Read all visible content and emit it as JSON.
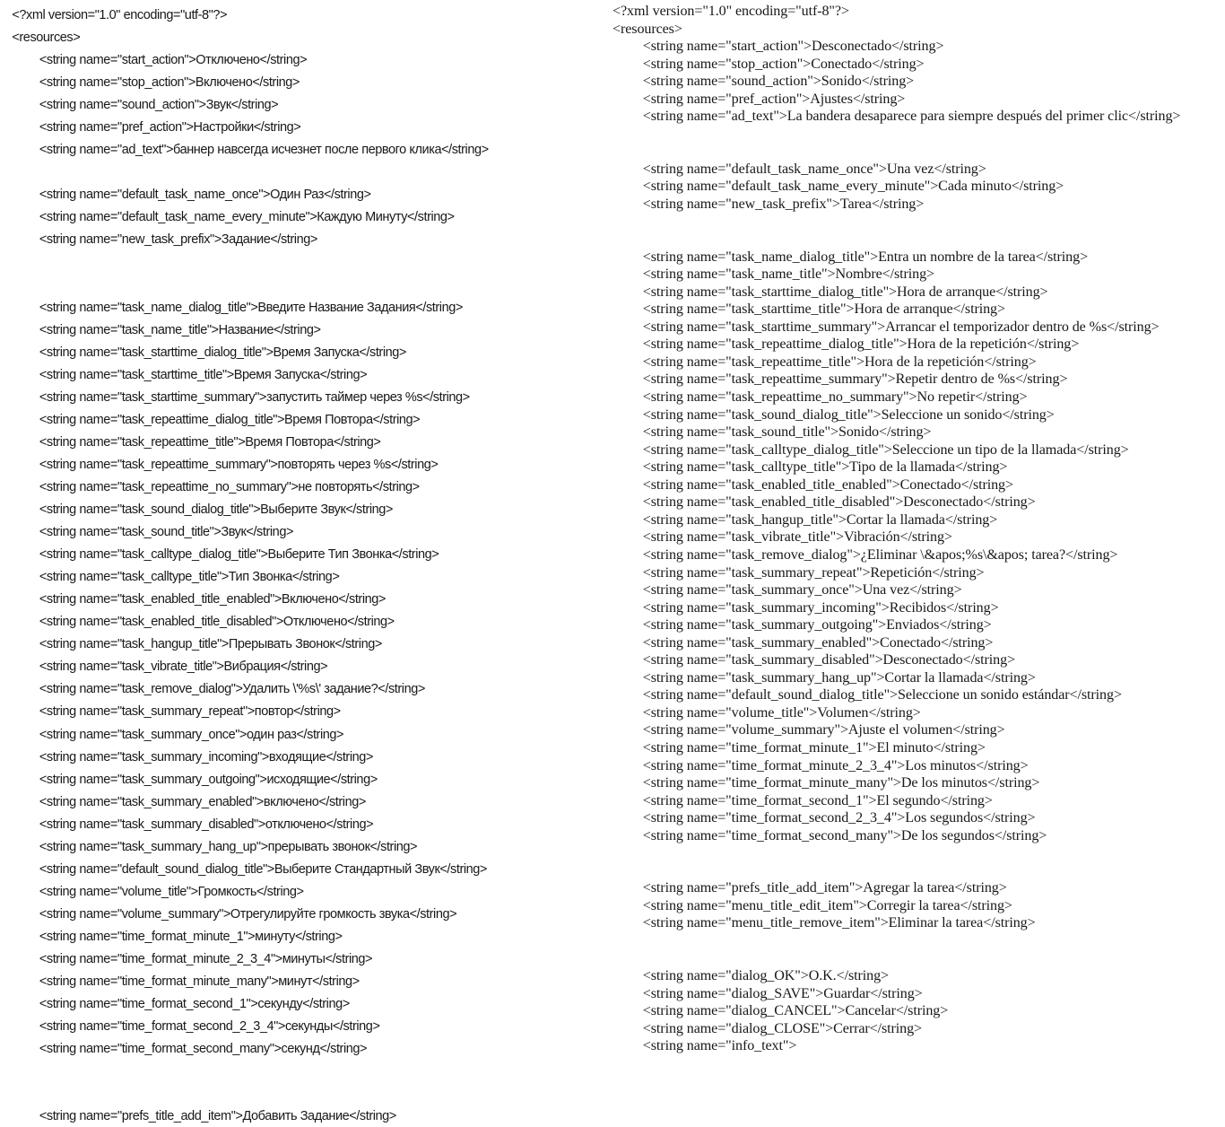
{
  "document": {
    "type": "xml-resource-comparison",
    "background_color": "#ffffff",
    "text_color": "#181818",
    "columns": [
      {
        "id": "left",
        "language": "Russian",
        "font_style": "sans-serif",
        "lines": [
          {
            "indent": 0,
            "text": "<?xml version=\"1.0\" encoding=\"utf-8\"?>"
          },
          {
            "indent": 0,
            "text": "<resources>"
          },
          {
            "indent": 1,
            "text": "<string name=\"start_action\">Отключено</string>"
          },
          {
            "indent": 1,
            "text": "<string name=\"stop_action\">Включено</string>"
          },
          {
            "indent": 1,
            "text": "<string name=\"sound_action\">Звук</string>"
          },
          {
            "indent": 1,
            "text": "<string name=\"pref_action\">Настройки</string>"
          },
          {
            "indent": 1,
            "text": "<string name=\"ad_text\">баннер навсегда исчезнет после первого клика</string>"
          },
          {
            "indent": 0,
            "text": ""
          },
          {
            "indent": 1,
            "text": "<string name=\"default_task_name_once\">Один Раз</string>"
          },
          {
            "indent": 1,
            "text": "<string name=\"default_task_name_every_minute\">Каждую Минуту</string>"
          },
          {
            "indent": 1,
            "text": "<string name=\"new_task_prefix\">Задание</string>"
          },
          {
            "indent": 0,
            "text": ""
          },
          {
            "indent": 0,
            "text": ""
          },
          {
            "indent": 1,
            "text": "<string name=\"task_name_dialog_title\">Введите Название Задания</string>"
          },
          {
            "indent": 1,
            "text": "<string name=\"task_name_title\">Название</string>"
          },
          {
            "indent": 1,
            "text": "<string name=\"task_starttime_dialog_title\">Время Запуска</string>"
          },
          {
            "indent": 1,
            "text": "<string name=\"task_starttime_title\">Время Запуска</string>"
          },
          {
            "indent": 1,
            "text": "<string name=\"task_starttime_summary\">запустить таймер через %s</string>"
          },
          {
            "indent": 1,
            "text": "<string name=\"task_repeattime_dialog_title\">Время Повтора</string>"
          },
          {
            "indent": 1,
            "text": "<string name=\"task_repeattime_title\">Время Повтора</string>"
          },
          {
            "indent": 1,
            "text": "<string name=\"task_repeattime_summary\">повторять через %s</string>"
          },
          {
            "indent": 1,
            "text": "<string name=\"task_repeattime_no_summary\">не повторять</string>"
          },
          {
            "indent": 1,
            "text": "<string name=\"task_sound_dialog_title\">Выберите Звук</string>"
          },
          {
            "indent": 1,
            "text": "<string name=\"task_sound_title\">Звук</string>"
          },
          {
            "indent": 1,
            "text": "<string name=\"task_calltype_dialog_title\">Выберите Тип Звонка</string>"
          },
          {
            "indent": 1,
            "text": "<string name=\"task_calltype_title\">Тип Звонка</string>"
          },
          {
            "indent": 1,
            "text": "<string name=\"task_enabled_title_enabled\">Включено</string>"
          },
          {
            "indent": 1,
            "text": "<string name=\"task_enabled_title_disabled\">Отключено</string>"
          },
          {
            "indent": 1,
            "text": "<string name=\"task_hangup_title\">Прерывать Звонок</string>"
          },
          {
            "indent": 1,
            "text": "<string name=\"task_vibrate_title\">Вибрация</string>"
          },
          {
            "indent": 1,
            "text": "<string name=\"task_remove_dialog\">Удалить \\'%s\\' задание?</string>"
          },
          {
            "indent": 1,
            "text": "<string name=\"task_summary_repeat\">повтор</string>"
          },
          {
            "indent": 1,
            "text": "<string name=\"task_summary_once\">один раз</string>"
          },
          {
            "indent": 1,
            "text": "<string name=\"task_summary_incoming\">входящие</string>"
          },
          {
            "indent": 1,
            "text": "<string name=\"task_summary_outgoing\">исходящие</string>"
          },
          {
            "indent": 1,
            "text": "<string name=\"task_summary_enabled\">включено</string>"
          },
          {
            "indent": 1,
            "text": "<string name=\"task_summary_disabled\">отключено</string>"
          },
          {
            "indent": 1,
            "text": "<string name=\"task_summary_hang_up\">прерывать звонок</string>"
          },
          {
            "indent": 1,
            "text": "<string name=\"default_sound_dialog_title\">Выберите Стандартный Звук</string>"
          },
          {
            "indent": 1,
            "text": "<string name=\"volume_title\">Громкость</string>"
          },
          {
            "indent": 1,
            "text": "<string name=\"volume_summary\">Отрегулируйте громкость звука</string>"
          },
          {
            "indent": 1,
            "text": "<string name=\"time_format_minute_1\">минуту</string>"
          },
          {
            "indent": 1,
            "text": "<string name=\"time_format_minute_2_3_4\">минуты</string>"
          },
          {
            "indent": 1,
            "text": "<string name=\"time_format_minute_many\">минут</string>"
          },
          {
            "indent": 1,
            "text": "<string name=\"time_format_second_1\">секунду</string>"
          },
          {
            "indent": 1,
            "text": "<string name=\"time_format_second_2_3_4\">секунды</string>"
          },
          {
            "indent": 1,
            "text": "<string name=\"time_format_second_many\">секунд</string>"
          },
          {
            "indent": 0,
            "text": ""
          },
          {
            "indent": 0,
            "text": ""
          },
          {
            "indent": 1,
            "text": "<string name=\"prefs_title_add_item\">Добавить Задание</string>"
          }
        ]
      },
      {
        "id": "right",
        "language": "Spanish",
        "font_style": "serif",
        "lines": [
          {
            "indent": 0,
            "text": "<?xml version=\"1.0\" encoding=\"utf-8\"?>"
          },
          {
            "indent": 0,
            "text": "<resources>"
          },
          {
            "indent": 1,
            "text": "<string name=\"start_action\">Desconectado</string>"
          },
          {
            "indent": 1,
            "text": "<string name=\"stop_action\">Conectado</string>"
          },
          {
            "indent": 1,
            "text": "<string name=\"sound_action\">Sonido</string>"
          },
          {
            "indent": 1,
            "text": "<string name=\"pref_action\">Ajustes</string>"
          },
          {
            "indent": 1,
            "text": "<string name=\"ad_text\">La bandera desaparece para siempre después del primer clic</string>"
          },
          {
            "indent": 0,
            "text": ""
          },
          {
            "indent": 0,
            "text": ""
          },
          {
            "indent": 1,
            "text": "<string name=\"default_task_name_once\">Una vez</string>"
          },
          {
            "indent": 1,
            "text": "<string name=\"default_task_name_every_minute\">Cada minuto</string>"
          },
          {
            "indent": 1,
            "text": "<string name=\"new_task_prefix\">Tarea</string>"
          },
          {
            "indent": 0,
            "text": ""
          },
          {
            "indent": 0,
            "text": ""
          },
          {
            "indent": 1,
            "text": "<string name=\"task_name_dialog_title\">Entra un nombre de la tarea</string>"
          },
          {
            "indent": 1,
            "text": "<string name=\"task_name_title\">Nombre</string>"
          },
          {
            "indent": 1,
            "text": "<string name=\"task_starttime_dialog_title\">Hora de arranque</string>"
          },
          {
            "indent": 1,
            "text": "<string name=\"task_starttime_title\">Hora de arranque</string>"
          },
          {
            "indent": 1,
            "text": "<string name=\"task_starttime_summary\">Arrancar el temporizador dentro de %s</string>"
          },
          {
            "indent": 1,
            "text": "<string name=\"task_repeattime_dialog_title\">Hora de la repetición</string>"
          },
          {
            "indent": 1,
            "text": "<string name=\"task_repeattime_title\">Hora de la repetición</string>"
          },
          {
            "indent": 1,
            "text": "<string name=\"task_repeattime_summary\">Repetir dentro de %s</string>"
          },
          {
            "indent": 1,
            "text": "<string name=\"task_repeattime_no_summary\">No repetir</string>"
          },
          {
            "indent": 1,
            "text": "<string name=\"task_sound_dialog_title\">Seleccione un sonido</string>"
          },
          {
            "indent": 1,
            "text": "<string name=\"task_sound_title\">Sonido</string>"
          },
          {
            "indent": 1,
            "text": "<string name=\"task_calltype_dialog_title\">Seleccione un tipo de la llamada</string>"
          },
          {
            "indent": 1,
            "text": "<string name=\"task_calltype_title\">Tipo de la llamada</string>"
          },
          {
            "indent": 1,
            "text": "<string name=\"task_enabled_title_enabled\">Conectado</string>"
          },
          {
            "indent": 1,
            "text": "<string name=\"task_enabled_title_disabled\">Desconectado</string>"
          },
          {
            "indent": 1,
            "text": "<string name=\"task_hangup_title\">Cortar la llamada</string>"
          },
          {
            "indent": 1,
            "text": "<string name=\"task_vibrate_title\">Vibración</string>"
          },
          {
            "indent": 1,
            "text": "<string name=\"task_remove_dialog\">¿Eliminar \\&apos;%s\\&apos; tarea?</string>"
          },
          {
            "indent": 1,
            "text": "<string name=\"task_summary_repeat\">Repetición</string>"
          },
          {
            "indent": 1,
            "text": "<string name=\"task_summary_once\">Una vez</string>"
          },
          {
            "indent": 1,
            "text": "<string name=\"task_summary_incoming\">Recibidos</string>"
          },
          {
            "indent": 1,
            "text": "<string name=\"task_summary_outgoing\">Enviados</string>"
          },
          {
            "indent": 1,
            "text": "<string name=\"task_summary_enabled\">Conectado</string>"
          },
          {
            "indent": 1,
            "text": "<string name=\"task_summary_disabled\">Desconectado</string>"
          },
          {
            "indent": 1,
            "text": "<string name=\"task_summary_hang_up\">Cortar la llamada</string>"
          },
          {
            "indent": 1,
            "text": "<string name=\"default_sound_dialog_title\">Seleccione un sonido estándar</string>"
          },
          {
            "indent": 1,
            "text": "<string name=\"volume_title\">Volumen</string>"
          },
          {
            "indent": 1,
            "text": "<string name=\"volume_summary\">Ajuste el volumen</string>"
          },
          {
            "indent": 1,
            "text": "<string name=\"time_format_minute_1\">El minuto</string>"
          },
          {
            "indent": 1,
            "text": "<string name=\"time_format_minute_2_3_4\">Los minutos</string>"
          },
          {
            "indent": 1,
            "text": "<string name=\"time_format_minute_many\">De los minutos</string>"
          },
          {
            "indent": 1,
            "text": "<string name=\"time_format_second_1\">El segundo</string>"
          },
          {
            "indent": 1,
            "text": "<string name=\"time_format_second_2_3_4\">Los segundos</string>"
          },
          {
            "indent": 1,
            "text": "<string name=\"time_format_second_many\">De los segundos</string>"
          },
          {
            "indent": 0,
            "text": ""
          },
          {
            "indent": 0,
            "text": ""
          },
          {
            "indent": 1,
            "text": "<string name=\"prefs_title_add_item\">Agregar la tarea</string>"
          },
          {
            "indent": 1,
            "text": "<string name=\"menu_title_edit_item\">Corregir la tarea</string>"
          },
          {
            "indent": 1,
            "text": "<string name=\"menu_title_remove_item\">Eliminar la tarea</string>"
          },
          {
            "indent": 0,
            "text": ""
          },
          {
            "indent": 0,
            "text": ""
          },
          {
            "indent": 1,
            "text": "<string name=\"dialog_OK\">O.K.</string>"
          },
          {
            "indent": 1,
            "text": "<string name=\"dialog_SAVE\">Guardar</string>"
          },
          {
            "indent": 1,
            "text": "<string name=\"dialog_CANCEL\">Cancelar</string>"
          },
          {
            "indent": 1,
            "text": "<string name=\"dialog_CLOSE\">Cerrar</string>"
          },
          {
            "indent": 1,
            "text": "<string name=\"info_text\">"
          }
        ]
      }
    ]
  }
}
